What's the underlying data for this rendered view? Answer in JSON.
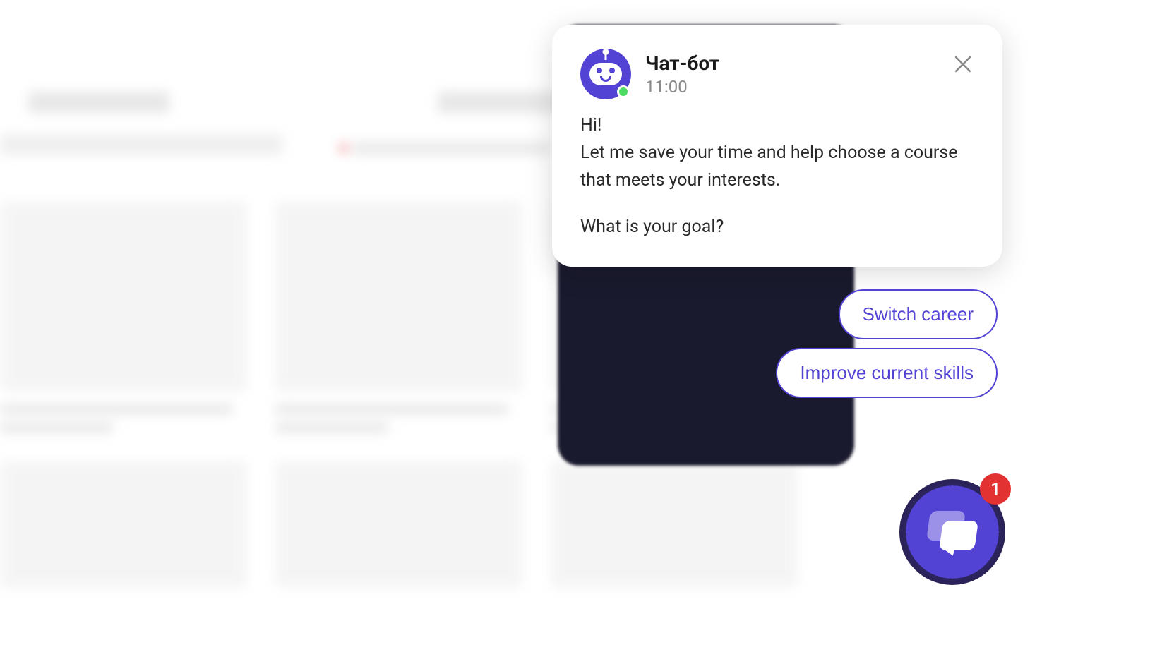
{
  "chat": {
    "bot_name": "Чат-бот",
    "timestamp": "11:00",
    "message_line1": "Hi!",
    "message_line2": "Let me save your time and help choose a course that meets your interests.",
    "message_line3": "What is your goal?"
  },
  "quick_replies": [
    {
      "label": "Switch career"
    },
    {
      "label": "Improve current skills"
    }
  ],
  "launcher": {
    "badge_count": "1"
  }
}
